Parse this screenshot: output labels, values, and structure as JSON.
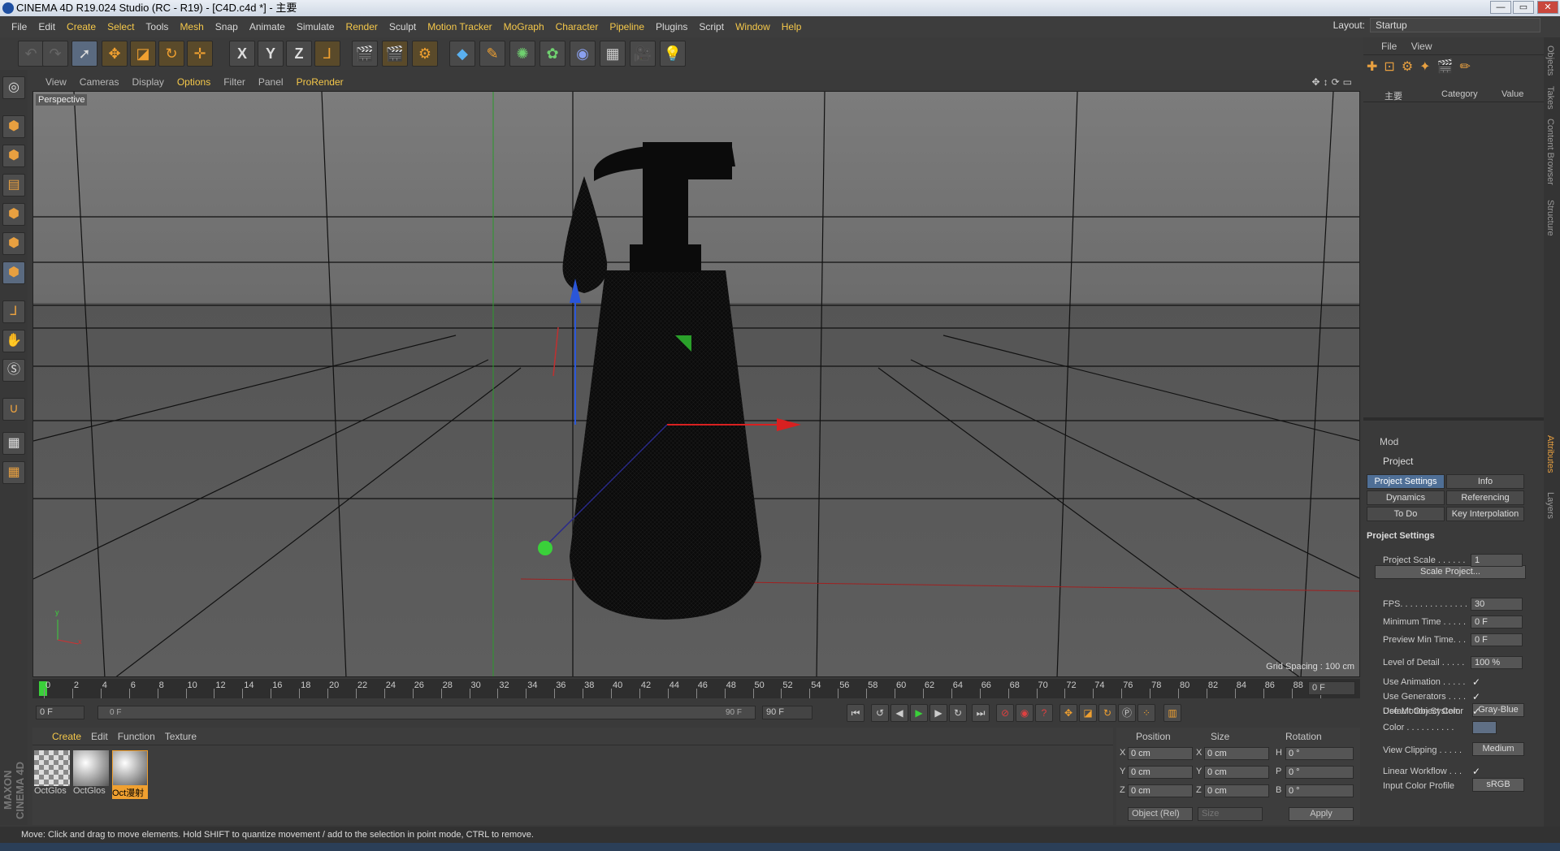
{
  "window": {
    "title": "CINEMA 4D R19.024 Studio (RC - R19) - [C4D.c4d *] - 主要",
    "min": "—",
    "max": "▭",
    "close": "✕"
  },
  "menu": [
    "File",
    "Edit",
    "Create",
    "Select",
    "Tools",
    "Mesh",
    "Snap",
    "Animate",
    "Simulate",
    "Render",
    "Sculpt",
    "Motion Tracker",
    "MoGraph",
    "Character",
    "Pipeline",
    "Plugins",
    "Script",
    "Window",
    "Help"
  ],
  "layout": {
    "label": "Layout:",
    "value": "Startup"
  },
  "toolbar": {
    "x": "X",
    "y": "Y",
    "z": "Z"
  },
  "viewport": {
    "menu": [
      "View",
      "Cameras",
      "Display",
      "Options",
      "Filter",
      "Panel",
      "ProRender"
    ],
    "label": "Perspective",
    "grid": "Grid Spacing : 100 cm",
    "axis_y": "y",
    "axis_x": "x"
  },
  "timeline": {
    "ticks": [
      "0",
      "2",
      "4",
      "6",
      "8",
      "10",
      "12",
      "14",
      "16",
      "18",
      "20",
      "22",
      "24",
      "26",
      "28",
      "30",
      "32",
      "34",
      "36",
      "38",
      "40",
      "42",
      "44",
      "46",
      "48",
      "50",
      "52",
      "54",
      "56",
      "58",
      "60",
      "62",
      "64",
      "66",
      "68",
      "70",
      "72",
      "74",
      "76",
      "78",
      "80",
      "82",
      "84",
      "86",
      "88",
      "90"
    ],
    "current": "0 F",
    "start": "0 F",
    "slider_start": "0 F",
    "slider_end": "90 F",
    "end": "90 F"
  },
  "materials": {
    "menu": [
      "Create",
      "Edit",
      "Function",
      "Texture"
    ],
    "items": [
      "OctGlos",
      "OctGlos",
      "Oct漫射"
    ]
  },
  "coords": {
    "headers": [
      "Position",
      "Size",
      "Rotation"
    ],
    "pos": [
      "0 cm",
      "0 cm",
      "0 cm"
    ],
    "size": [
      "0 cm",
      "0 cm",
      "0 cm"
    ],
    "rot": [
      "0 °",
      "0 °",
      "0 °"
    ],
    "labels_pos": [
      "X",
      "Y",
      "Z"
    ],
    "labels_size": [
      "X",
      "Y",
      "Z"
    ],
    "labels_rot": [
      "H",
      "P",
      "B"
    ],
    "mode": "Object (Rel)",
    "size_mode": "Size",
    "apply": "Apply"
  },
  "objects": {
    "menu": [
      "File",
      "View"
    ],
    "col_name": "主要",
    "col_category": "Category",
    "col_value": "Value"
  },
  "attributes": {
    "menu": "Mod",
    "title": "Project",
    "tabs": [
      "Project Settings",
      "Info",
      "Dynamics",
      "Referencing",
      "To Do",
      "Key Interpolation"
    ],
    "section": "Project Settings",
    "rows": [
      {
        "label": "Project Scale . . . . . .",
        "value": "1"
      },
      {
        "label": "FPS. . . . . . . . . . . . . . .",
        "value": "30"
      },
      {
        "label": "Minimum Time . . . . .",
        "value": "0 F"
      },
      {
        "label": "Preview Min Time. . .",
        "value": "0 F"
      },
      {
        "label": "Level of Detail . . . . .",
        "value": "100 %"
      }
    ],
    "scale_btn": "Scale Project...",
    "checks": [
      {
        "label": "Use Animation . . . . .",
        "value": "✓"
      },
      {
        "label": "Use Generators . . . .",
        "value": "✓"
      },
      {
        "label": "Use Motion System",
        "value": "✓"
      }
    ],
    "default_color": {
      "label": "Default Object Color",
      "value": "Gray-Blue"
    },
    "color_label": "Color . . . . . . . . . .",
    "view_clipping": {
      "label": "View Clipping . . . . .",
      "value": "Medium"
    },
    "linear": {
      "label": "Linear Workflow . . .",
      "value": "✓"
    },
    "input_profile": {
      "label": "Input Color Profile",
      "value": "sRGB"
    }
  },
  "side_tabs": [
    "Objects",
    "Takes",
    "Content Browser",
    "Structure",
    "Attributes",
    "Layers"
  ],
  "status": "Move: Click and drag to move elements. Hold SHIFT to quantize movement / add to the selection in point mode, CTRL to remove.",
  "brand": "MAXON CINEMA 4D"
}
